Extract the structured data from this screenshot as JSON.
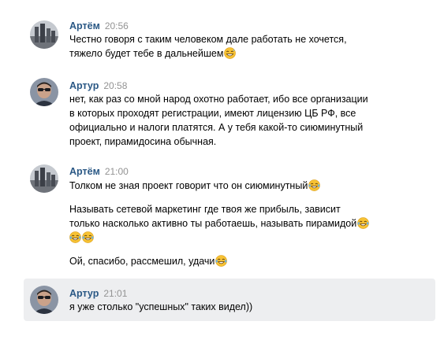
{
  "messages": [
    {
      "author": "Артём",
      "time": "20:56",
      "lines": [
        "Честно говоря с таким человеком дале работать не хочется,",
        "тяжело будет тебе в дальнейшем"
      ],
      "emoji": "sweat-smile-emoji"
    },
    {
      "author": "Артур",
      "time": "20:58",
      "lines": [
        "нет, как раз со мной народ охотно работает, ибо все организации",
        "в которых проходят регистрации, имеют лицензию ЦБ РФ, все",
        "официально и налоги платятся. А у тебя какой-то сиюминутный",
        "проект, пирамидосина обычная."
      ]
    },
    {
      "author": "Артём",
      "time": "21:00",
      "line1": "Толком не зная проект говорит что он сиюминутный",
      "line2a": "Называть сетевой маркетинг где твоя же прибыль, зависит",
      "line2b": "только насколько активно ты работаешь, называть пирамидой",
      "line3": "Ой, спасибо, рассмешил, удачи",
      "emoji": "tears-of-joy-emoji"
    },
    {
      "author": "Артур",
      "time": "21:01",
      "lines": [
        "я уже столько \"успешных\" таких видел))"
      ]
    }
  ]
}
